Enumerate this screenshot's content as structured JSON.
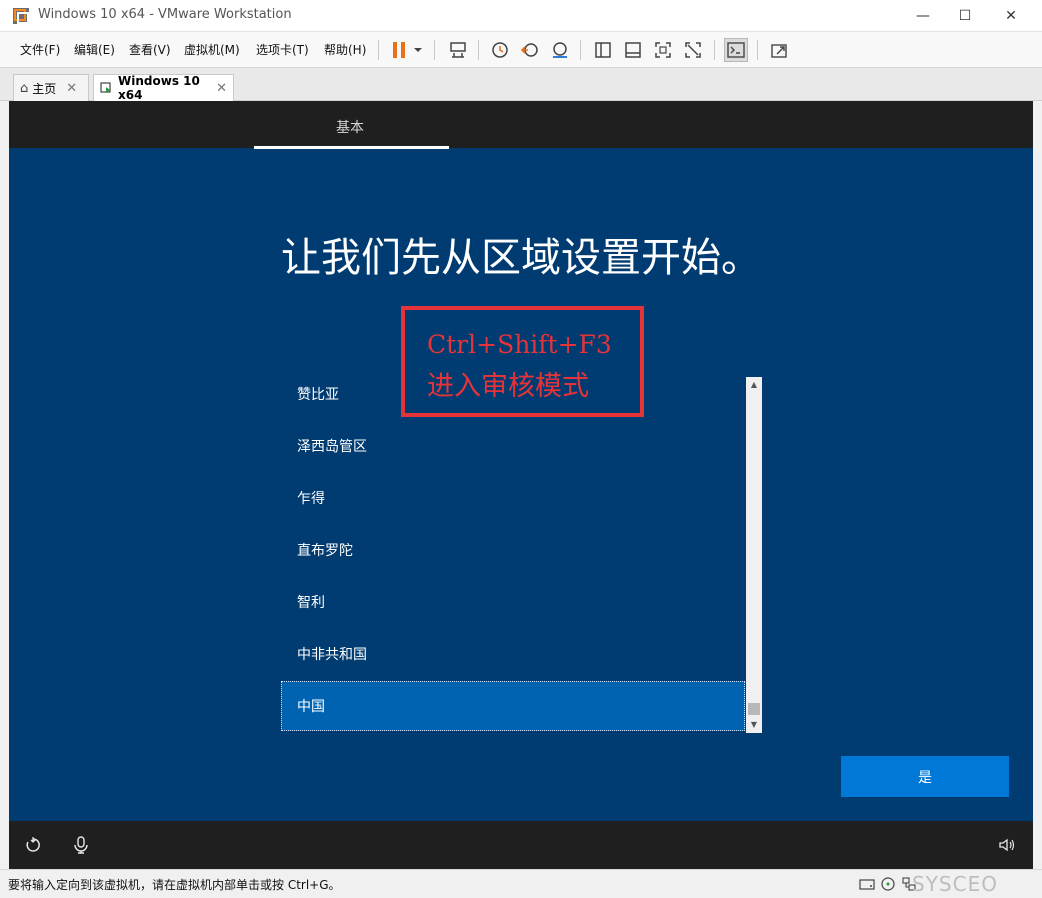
{
  "window": {
    "title": "Windows 10 x64 - VMware Workstation",
    "controls": {
      "minimize": "—",
      "maximize": "☐",
      "close": "✕"
    }
  },
  "menu": {
    "items": [
      "文件(F)",
      "编辑(E)",
      "查看(V)",
      "虚拟机(M)",
      "选项卡(T)",
      "帮助(H)"
    ]
  },
  "toolbar": {
    "icons": [
      "pause-icon",
      "dropdown-icon",
      "send-ctrl-alt-del-icon",
      "snapshot-icon",
      "revert-snapshot-icon",
      "snapshot-manager-icon",
      "library-view-icon",
      "thumbnail-view-icon",
      "fullscreen-icon",
      "unity-icon",
      "console-icon",
      "stretch-icon"
    ],
    "accent_color": "#e8711c"
  },
  "tabs": [
    {
      "label": "主页",
      "icon": "home-icon",
      "close": "✕",
      "active": false
    },
    {
      "label": "Windows 10 x64",
      "icon": "vm-icon",
      "close": "✕",
      "active": true
    }
  ],
  "oobe": {
    "step_label": "基本",
    "heading": "让我们先从区域设置开始。",
    "regions": [
      "赞比亚",
      "泽西岛管区",
      "乍得",
      "直布罗陀",
      "智利",
      "中非共和国",
      "中国"
    ],
    "selected_region": "中国",
    "yes_button": "是",
    "background_color": "#003c71",
    "button_color": "#0078d7"
  },
  "annotation": {
    "line1": "Ctrl+Shift+F3",
    "line2": "进入审核模式",
    "color": "#e5333a"
  },
  "statusbar": {
    "message": "要将输入定向到该虚拟机，请在虚拟机内部单击或按 Ctrl+G。",
    "watermark": "SYSCEO"
  }
}
